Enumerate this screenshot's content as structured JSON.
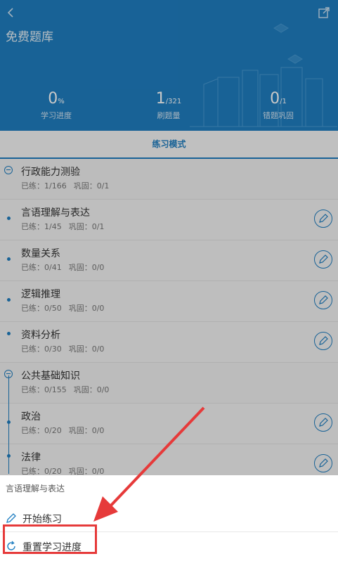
{
  "header": {
    "title": "免费题库",
    "stats": [
      {
        "value": "0",
        "unit": "%",
        "label": "学习进度"
      },
      {
        "value": "1",
        "unit": "/321",
        "label": "刷题量"
      },
      {
        "value": "0",
        "unit": "/1",
        "label": "错题巩固"
      }
    ]
  },
  "tab": {
    "label": "练习模式"
  },
  "groups": [
    {
      "title": "行政能力测验",
      "done_label": "已练：1/166",
      "review_label": "巩固：0/1",
      "items": [
        {
          "title": "言语理解与表达",
          "done_label": "已练：1/45",
          "review_label": "巩固：0/1"
        },
        {
          "title": "数量关系",
          "done_label": "已练：0/41",
          "review_label": "巩固：0/0"
        },
        {
          "title": "逻辑推理",
          "done_label": "已练：0/50",
          "review_label": "巩固：0/0"
        },
        {
          "title": "资料分析",
          "done_label": "已练：0/30",
          "review_label": "巩固：0/0"
        }
      ]
    },
    {
      "title": "公共基础知识",
      "done_label": "已练：0/155",
      "review_label": "巩固：0/0",
      "items": [
        {
          "title": "政治",
          "done_label": "已练：0/20",
          "review_label": "巩固：0/0"
        },
        {
          "title": "法律",
          "done_label": "已练：0/20",
          "review_label": "巩固：0/0"
        }
      ]
    }
  ],
  "sheet": {
    "title": "言语理解与表达",
    "start_label": "开始练习",
    "reset_label": "重置学习进度"
  },
  "colors": {
    "primary": "#1f7ec1",
    "highlight": "#e63a3a"
  }
}
